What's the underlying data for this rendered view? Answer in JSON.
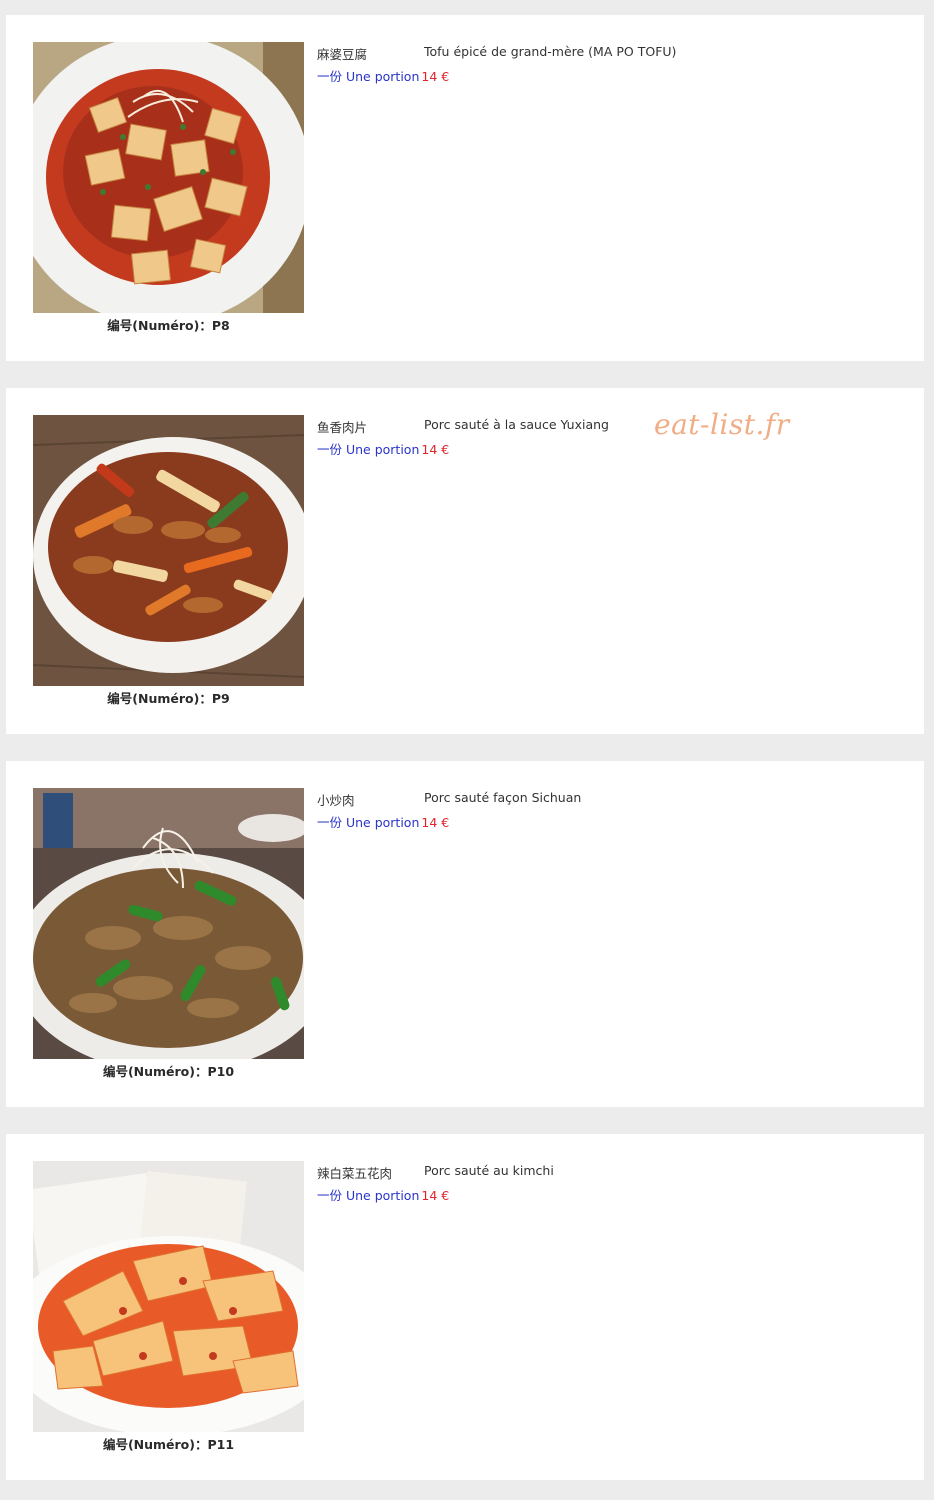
{
  "watermark": "eat-list.fr",
  "items": [
    {
      "name_zh": "麻婆豆腐",
      "name_fr": "Tofu épicé de grand-mère (MA PO TOFU)",
      "portion": "一份 Une portion",
      "price": "14 €",
      "number": "编号(Numéro)：P8",
      "image": "mapo-tofu-photo"
    },
    {
      "name_zh": "鱼香肉片",
      "name_fr": "Porc sauté à la sauce Yuxiang",
      "portion": "一份 Une portion",
      "price": "14 €",
      "number": "编号(Numéro)：P9",
      "image": "yuxiang-pork-photo"
    },
    {
      "name_zh": "小炒肉",
      "name_fr": "Porc sauté façon Sichuan",
      "portion": "一份 Une portion",
      "price": "14 €",
      "number": "编号(Numéro)：P10",
      "image": "sichuan-stir-fry-pork-photo"
    },
    {
      "name_zh": "辣白菜五花肉",
      "name_fr": "Porc sauté au kimchi",
      "portion": "一份 Une portion",
      "price": "14 €",
      "number": "编号(Numéro)：P11",
      "image": "kimchi-pork-photo"
    }
  ]
}
